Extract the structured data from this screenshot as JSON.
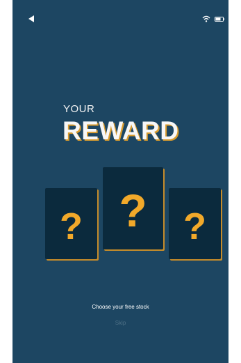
{
  "header": {
    "back_icon": "back-triangle-icon",
    "wifi_icon": "wifi-icon",
    "battery_icon": "battery-icon"
  },
  "title": {
    "line1": "YOUR",
    "line2": "REWARD"
  },
  "cards": [
    {
      "symbol": "?"
    },
    {
      "symbol": "?"
    },
    {
      "symbol": "?"
    }
  ],
  "instruction": "Choose your free stock",
  "skip_label": "Skip",
  "colors": {
    "background": "#1d4662",
    "card": "#0b2a3d",
    "accent": "#f2a92a",
    "skip_text": "#4d6f85"
  }
}
